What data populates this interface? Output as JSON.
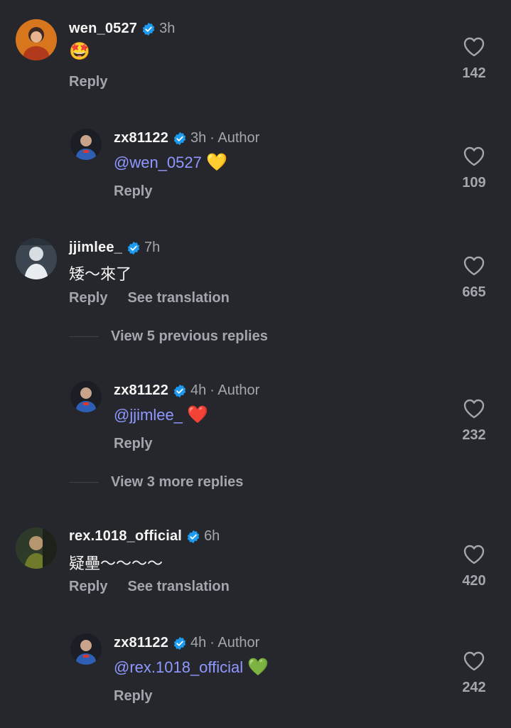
{
  "comments": [
    {
      "username": "wen_0527",
      "time": "3h",
      "text": "🤩",
      "actions": {
        "reply": "Reply"
      },
      "likes": "142",
      "reply": {
        "username": "zx81122",
        "time": "3h",
        "author_tag": "· Author",
        "mention": "@wen_0527",
        "emoji": "💛",
        "actions": {
          "reply": "Reply"
        },
        "likes": "109"
      }
    },
    {
      "username": "jjimlee_",
      "time": "7h",
      "text": "矮～來了",
      "actions": {
        "reply": "Reply",
        "translate": "See translation"
      },
      "likes": "665",
      "view_previous": "View 5 previous replies",
      "reply": {
        "username": "zx81122",
        "time": "4h",
        "author_tag": "· Author",
        "mention": "@jjimlee_",
        "emoji": "❤️",
        "actions": {
          "reply": "Reply"
        },
        "likes": "232"
      },
      "view_more": "View 3 more replies"
    },
    {
      "username": "rex.1018_official",
      "time": "6h",
      "text": "疑壘～～～～",
      "actions": {
        "reply": "Reply",
        "translate": "See translation"
      },
      "likes": "420",
      "reply": {
        "username": "zx81122",
        "time": "4h",
        "author_tag": "· Author",
        "mention": "@rex.1018_official",
        "emoji": "💚",
        "actions": {
          "reply": "Reply"
        },
        "likes": "242"
      }
    }
  ],
  "colors": {
    "background": "#25272c",
    "mention": "#8f98ff",
    "verified": "#1d9bf0",
    "muted": "#a3a7ad"
  },
  "icons": {
    "verified": "verified-badge-icon",
    "like": "heart-outline-icon"
  }
}
